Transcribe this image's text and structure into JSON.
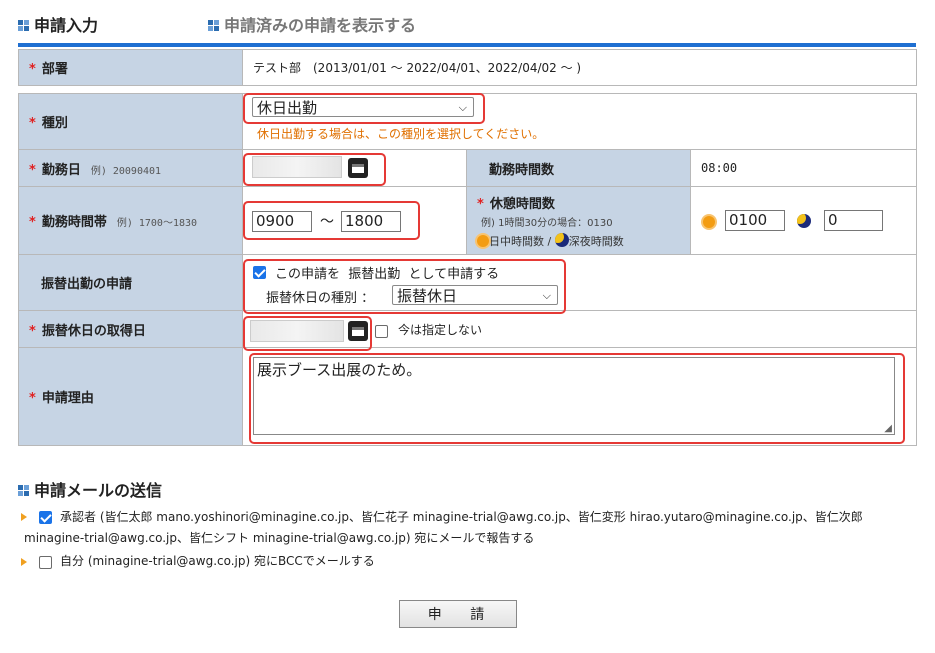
{
  "tabs": {
    "input": "申請入力",
    "history": "申請済みの申請を表示する"
  },
  "form": {
    "dept": {
      "label": "部署",
      "value": "テスト部　(2013/01/01 ～ 2022/04/01、2022/04/02 ～ )"
    },
    "type": {
      "label": "種別",
      "selected": "休日出勤",
      "note": "休日出勤する場合は、この種別を選択してください。"
    },
    "workday": {
      "label": "勤務日",
      "example": "例) 20090401"
    },
    "worktime_count": {
      "label": "勤務時間数",
      "value": "08:00"
    },
    "worktime": {
      "label": "勤務時間帯",
      "example": "例) 1700～1830",
      "start": "0900",
      "sep": "～",
      "end": "1800"
    },
    "break": {
      "label": "休憩時間数",
      "example": "例) 1時間30分の場合：0130",
      "day_label": "日中時間数",
      "slash": "/",
      "night_label": "深夜時間数",
      "day_value": "0100",
      "night_value": "0"
    },
    "substitute": {
      "label": "振替出勤の申請",
      "check_text": "この申請を  振替出勤  として申請する",
      "checked": true,
      "holiday_type_label": "振替休日の種別 ：",
      "holiday_type_value": "振替休日"
    },
    "holiday_date": {
      "label": "振替休日の取得日",
      "undecided_label": "今は指定しない",
      "undecided_checked": false
    },
    "reason": {
      "label": "申請理由",
      "value": "展示ブース出展のため。"
    }
  },
  "mail": {
    "title": "申請メールの送信",
    "approver_line1": "承認者 (皆仁太郎 mano.yoshinori@minagine.co.jp、皆仁花子 minagine-trial@awg.co.jp、皆仁変形 hirao.yutaro@minagine.co.jp、皆仁次郎",
    "approver_line2": "minagine-trial@awg.co.jp、皆仁シフト minagine-trial@awg.co.jp)  宛にメールで報告する",
    "approver_checked": true,
    "self_line": "自分 (minagine-trial@awg.co.jp)  宛にBCCでメールする",
    "self_checked": false
  },
  "submit_label": "申 請",
  "colors": {
    "label_bg": "#c6d4e4",
    "accent_blue": "#1f6fd1",
    "required": "#e02020",
    "highlight": "#e53935",
    "note": "#e07000"
  }
}
